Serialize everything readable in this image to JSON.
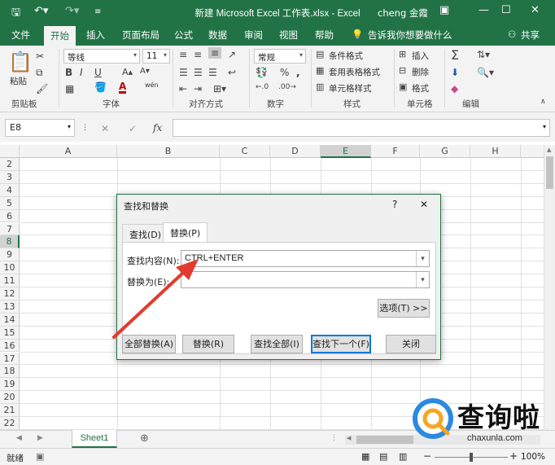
{
  "titlebar": {
    "title": "新建 Microsoft Excel 工作表.xlsx  -  Excel",
    "user": "cheng 金霞",
    "save_icon": "save-icon",
    "undo_icon": "undo-icon",
    "redo_icon": "redo-icon"
  },
  "ribbon_tabs": {
    "file": "文件",
    "home": "开始",
    "insert": "插入",
    "page_layout": "页面布局",
    "formulas": "公式",
    "data": "数据",
    "review": "审阅",
    "view": "视图",
    "help": "帮助",
    "tell_me": "告诉我你想要做什么",
    "share": "共享"
  },
  "ribbon": {
    "paste": "粘贴",
    "clipboard": "剪贴板",
    "font_name": "等线",
    "font_size": "11",
    "bold": "B",
    "italic": "I",
    "underline": "U",
    "font_group": "字体",
    "wen": "wén",
    "alignment_group": "对齐方式",
    "number_format": "常规",
    "percent": "%",
    "comma": ",",
    "number_group": "数字",
    "conditional_format": "条件格式",
    "format_as_table": "套用表格格式",
    "cell_styles": "单元格样式",
    "styles_group": "样式",
    "insert_cells": "插入",
    "delete_cells": "删除",
    "format_cells": "格式",
    "cells_group": "单元格",
    "editing_group": "编辑",
    "sigma": "Σ"
  },
  "formula_bar": {
    "name_box": "E8",
    "fx": "fx",
    "value": ""
  },
  "grid": {
    "columns": [
      "A",
      "B",
      "C",
      "D",
      "E",
      "F",
      "G",
      "H"
    ],
    "rows": [
      "2",
      "3",
      "4",
      "5",
      "6",
      "7",
      "8",
      "9",
      "10",
      "11",
      "12",
      "13",
      "14",
      "15",
      "16",
      "17",
      "18",
      "19",
      "20",
      "21",
      "22"
    ],
    "selected_col": "E",
    "selected_row": "8"
  },
  "sheets": {
    "active": "Sheet1",
    "add": "⊕"
  },
  "status": {
    "ready": "就绪",
    "zoom": "100%"
  },
  "dialog": {
    "title": "查找和替换",
    "help": "?",
    "close": "✕",
    "tab_find": "查找(D)",
    "tab_replace": "替换(P)",
    "find_label": "查找内容(N):",
    "find_value": "CTRL+ENTER",
    "replace_label": "替换为(E):",
    "replace_value": "",
    "options": "选项(T) >>",
    "replace_all": "全部替换(A)",
    "replace": "替换(R)",
    "find_all": "查找全部(I)",
    "find_next": "查找下一个(F)",
    "close_btn": "关闭"
  },
  "watermark": {
    "brand": "查询啦",
    "url": "chaxunla.com"
  },
  "colors": {
    "excel_green": "#217346",
    "arrow_red": "#e23b2e"
  }
}
